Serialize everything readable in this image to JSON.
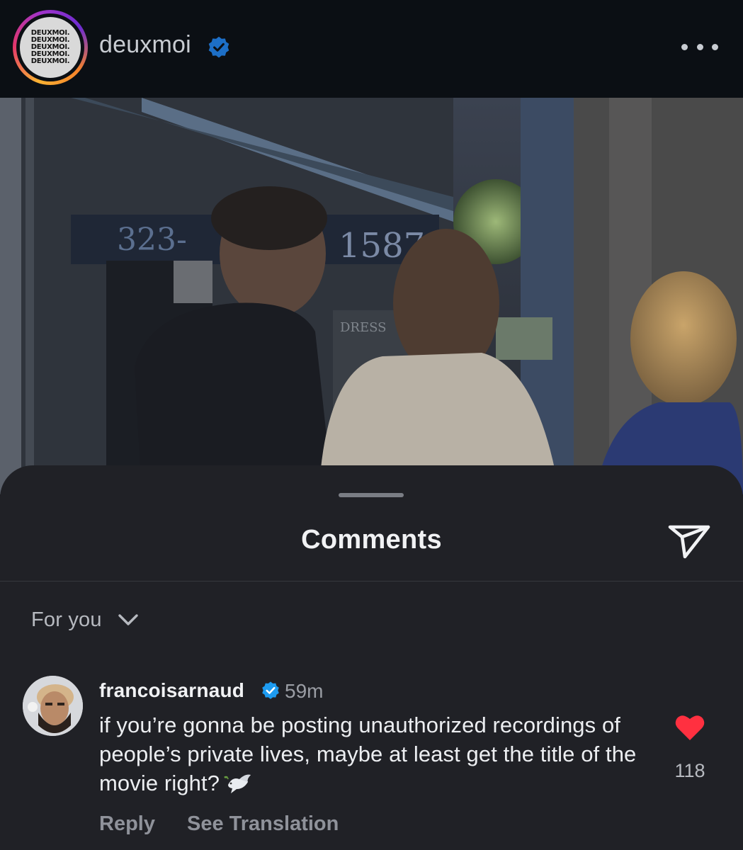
{
  "post": {
    "username": "deuxmoi",
    "avatar_logo_lines": [
      "DEUXMOI.",
      "DEUXMOI.",
      "DEUXMOI.",
      "DEUXMOI.",
      "DEUXMOI."
    ],
    "verified_icon": "verified-badge-icon",
    "more_icon": "more-horizontal-icon"
  },
  "video": {
    "scene_text_1": "323-",
    "scene_text_2": "1587",
    "scene_text_3": "DRESS"
  },
  "comments": {
    "title": "Comments",
    "share_icon": "send-icon",
    "sort": {
      "label": "For you",
      "icon": "chevron-down-icon"
    },
    "items": [
      {
        "username": "francoisarnaud",
        "verified": true,
        "time": "59m",
        "text": "if you’re gonna be posting unauthorized recordings of people’s private lives, maybe at least get the title of the movie right?",
        "emoji": "dove-icon",
        "liked": true,
        "like_count": "118",
        "reply_label": "Reply",
        "translate_label": "See Translation"
      }
    ]
  },
  "colors": {
    "header_bg": "#0b0f14",
    "sheet_bg": "#202126",
    "verified_blue": "#1d9bf0",
    "like_red": "#ff3040"
  }
}
